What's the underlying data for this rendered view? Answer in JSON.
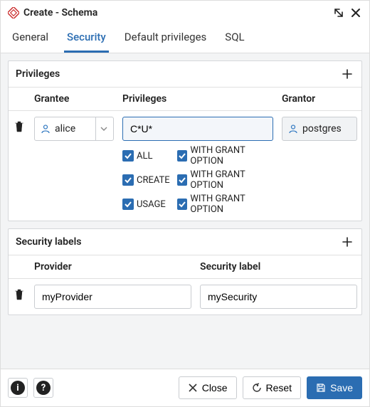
{
  "header": {
    "title": "Create - Schema"
  },
  "tabs": {
    "general": "General",
    "security": "Security",
    "default_privileges": "Default privileges",
    "sql": "SQL"
  },
  "privileges": {
    "title": "Privileges",
    "columns": {
      "grantee": "Grantee",
      "privileges": "Privileges",
      "grantor": "Grantor"
    },
    "rows": [
      {
        "grantee": "alice",
        "priv_string": "C*U*",
        "grantor": "postgres",
        "checks": {
          "all": "ALL",
          "all_wgo": "WITH GRANT OPTION",
          "create": "CREATE",
          "create_wgo": "WITH GRANT OPTION",
          "usage": "USAGE",
          "usage_wgo": "WITH GRANT OPTION"
        }
      }
    ]
  },
  "security_labels": {
    "title": "Security labels",
    "columns": {
      "provider": "Provider",
      "label": "Security label"
    },
    "rows": [
      {
        "provider": "myProvider",
        "label": "mySecurity"
      }
    ]
  },
  "footer": {
    "close": "Close",
    "reset": "Reset",
    "save": "Save"
  }
}
